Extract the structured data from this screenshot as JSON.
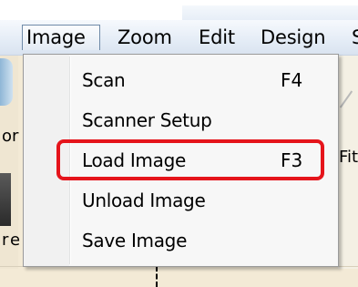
{
  "menubar": {
    "items": [
      {
        "label": "Image",
        "active": true
      },
      {
        "label": "Zoom",
        "active": false
      },
      {
        "label": "Edit",
        "active": false
      },
      {
        "label": "Design",
        "active": false
      },
      {
        "label": "S",
        "active": false
      }
    ]
  },
  "background": {
    "fragments": [
      "or",
      "r",
      "e",
      "Fit"
    ]
  },
  "dropdown": {
    "items": [
      {
        "label": "Scan",
        "shortcut": "F4"
      },
      {
        "label": "Scanner Setup",
        "shortcut": ""
      },
      {
        "label": "Load Image",
        "shortcut": "F3",
        "highlighted": true
      },
      {
        "label": "Unload Image",
        "shortcut": ""
      },
      {
        "label": "Save Image",
        "shortcut": ""
      }
    ]
  },
  "colors": {
    "highlight_outline": "#e5141b",
    "menu_background": "#f7f7f7",
    "app_background": "#f3ead6"
  }
}
